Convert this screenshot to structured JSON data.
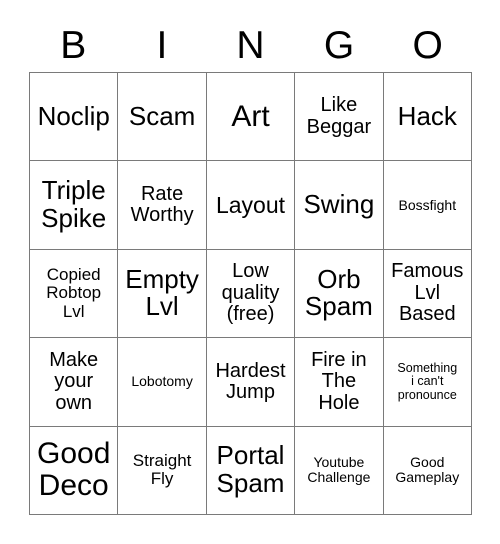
{
  "card": {
    "title": "Bingo Card",
    "header_letters": [
      "B",
      "I",
      "N",
      "G",
      "O"
    ],
    "columns": 5,
    "rows": 5,
    "border_color": "#7a7a7a",
    "text_color": "#000000",
    "background_color": "#ffffff",
    "rows_data": [
      [
        {
          "text": "Noclip",
          "size": "xl"
        },
        {
          "text": "Scam",
          "size": "xl"
        },
        {
          "text": "Art",
          "size": "xxl"
        },
        {
          "text": "Like\nBeggar",
          "size": "md"
        },
        {
          "text": "Hack",
          "size": "xl"
        }
      ],
      [
        {
          "text": "Triple\nSpike",
          "size": "xl"
        },
        {
          "text": "Rate\nWorthy",
          "size": "md"
        },
        {
          "text": "Layout",
          "size": "lg"
        },
        {
          "text": "Swing",
          "size": "xl"
        },
        {
          "text": "Bossfight",
          "size": "xs"
        }
      ],
      [
        {
          "text": "Copied\nRobtop\nLvl",
          "size": "sm"
        },
        {
          "text": "Empty\nLvl",
          "size": "xl"
        },
        {
          "text": "Low\nquality\n(free)",
          "size": "md"
        },
        {
          "text": "Orb\nSpam",
          "size": "xl"
        },
        {
          "text": "Famous\nLvl\nBased",
          "size": "md"
        }
      ],
      [
        {
          "text": "Make\nyour\nown",
          "size": "md"
        },
        {
          "text": "Lobotomy",
          "size": "xs"
        },
        {
          "text": "Hardest\nJump",
          "size": "md"
        },
        {
          "text": "Fire in\nThe\nHole",
          "size": "md"
        },
        {
          "text": "Something\ni can't\npronounce",
          "size": "xxs"
        }
      ],
      [
        {
          "text": "Good\nDeco",
          "size": "xxl"
        },
        {
          "text": "Straight\nFly",
          "size": "sm"
        },
        {
          "text": "Portal\nSpam",
          "size": "xl"
        },
        {
          "text": "Youtube\nChallenge",
          "size": "xs"
        },
        {
          "text": "Good\nGameplay",
          "size": "xs"
        }
      ]
    ]
  }
}
